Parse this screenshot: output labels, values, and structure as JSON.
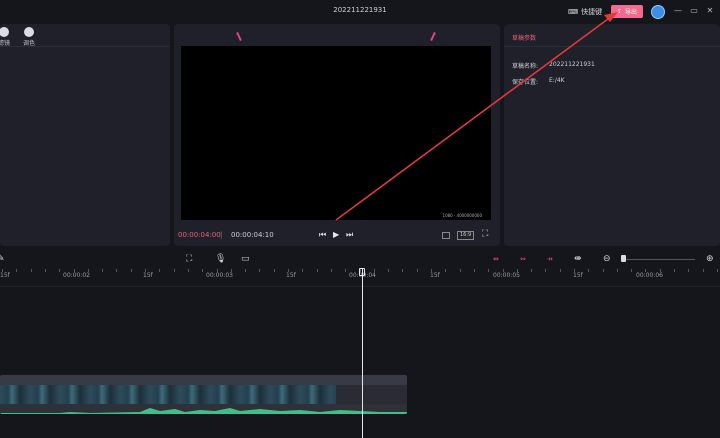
{
  "app": {
    "title": "202211221931"
  },
  "header": {
    "shortcut_label": "快捷键",
    "export_label": "导出"
  },
  "left_panel": {
    "tools": [
      {
        "label": "滤镜",
        "icon": "filter-icon"
      },
      {
        "label": "调色",
        "icon": "palette-icon"
      }
    ]
  },
  "player": {
    "current_time": "00:00:04:00",
    "separator": "|",
    "total_time": "00:00:04:10",
    "ratio_label": "16:9",
    "watermark": "1080 · 4000000000"
  },
  "draft_params": {
    "title": "草稿参数",
    "name_label": "草稿名称:",
    "name_value": "202211221931",
    "location_label": "保存位置:",
    "location_value": "E:/4K"
  },
  "ruler": {
    "labels": [
      "15f",
      "00:00:02",
      "15f",
      "00:00:03",
      "15f",
      "00:00:04",
      "15f",
      "00:00:05",
      "15f",
      "00:00:06"
    ]
  },
  "colors": {
    "accent": "#f26a8d",
    "timecode": "#e8617f",
    "background": "#15161c",
    "panel": "#1f2029",
    "arrow": "#e03a3a"
  }
}
